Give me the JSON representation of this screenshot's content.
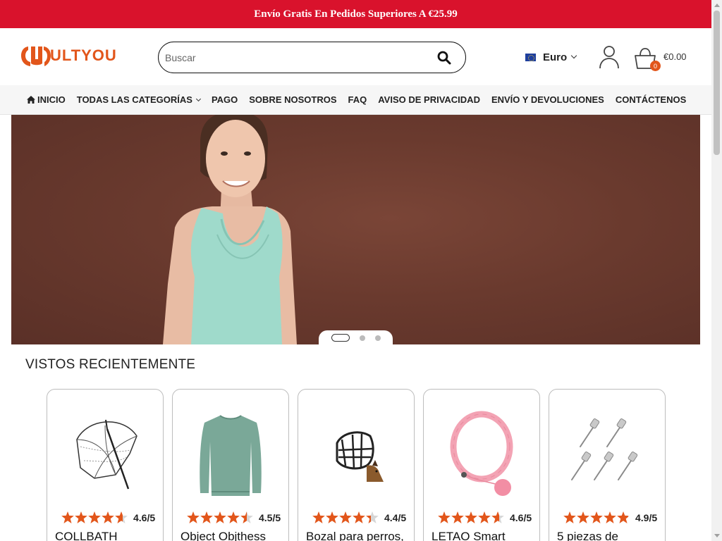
{
  "promo": {
    "text": "Envío Gratis En Pedidos Superiores A €25.99"
  },
  "header": {
    "logo_text": "ULTYOU",
    "search_placeholder": "Buscar",
    "currency": {
      "label": "Euro",
      "flag_icon": "eu-flag-icon"
    },
    "cart": {
      "count": "0",
      "total": "€0.00"
    }
  },
  "nav": {
    "items": [
      {
        "label": "INICIO",
        "icon": "home-icon"
      },
      {
        "label": "TODAS LAS CATEGORÍAS",
        "has_dropdown": true
      },
      {
        "label": "PAGO"
      },
      {
        "label": "SOBRE NOSOTROS"
      },
      {
        "label": "FAQ"
      },
      {
        "label": "AVISO DE PRIVACIDAD"
      },
      {
        "label": "ENVÍO Y DEVOLUCIONES"
      },
      {
        "label": "CONTÁCTENOS"
      }
    ]
  },
  "carousel": {
    "slide_count": 3,
    "active_index": 0
  },
  "recent": {
    "title": "VISTOS RECIENTEMENTE",
    "products": [
      {
        "title": "COLLBATH",
        "rating": 4.6,
        "rating_text": "4.6/5",
        "image": "lace-umbrella"
      },
      {
        "title": "Object Objthess",
        "rating": 4.5,
        "rating_text": "4.5/5",
        "image": "green-sweater"
      },
      {
        "title": "Bozal para perros,",
        "rating": 4.4,
        "rating_text": "4.4/5",
        "image": "dog-muzzle"
      },
      {
        "title": "LETAO Smart",
        "rating": 4.6,
        "rating_text": "4.6/5",
        "image": "pink-hula-hoop"
      },
      {
        "title": "5 piezas de",
        "rating": 4.9,
        "rating_text": "4.9/5",
        "image": "inflation-needles"
      }
    ]
  },
  "colors": {
    "brand_red": "#d9122c",
    "logo_orange": "#e2561b",
    "star": "#e2561b"
  }
}
